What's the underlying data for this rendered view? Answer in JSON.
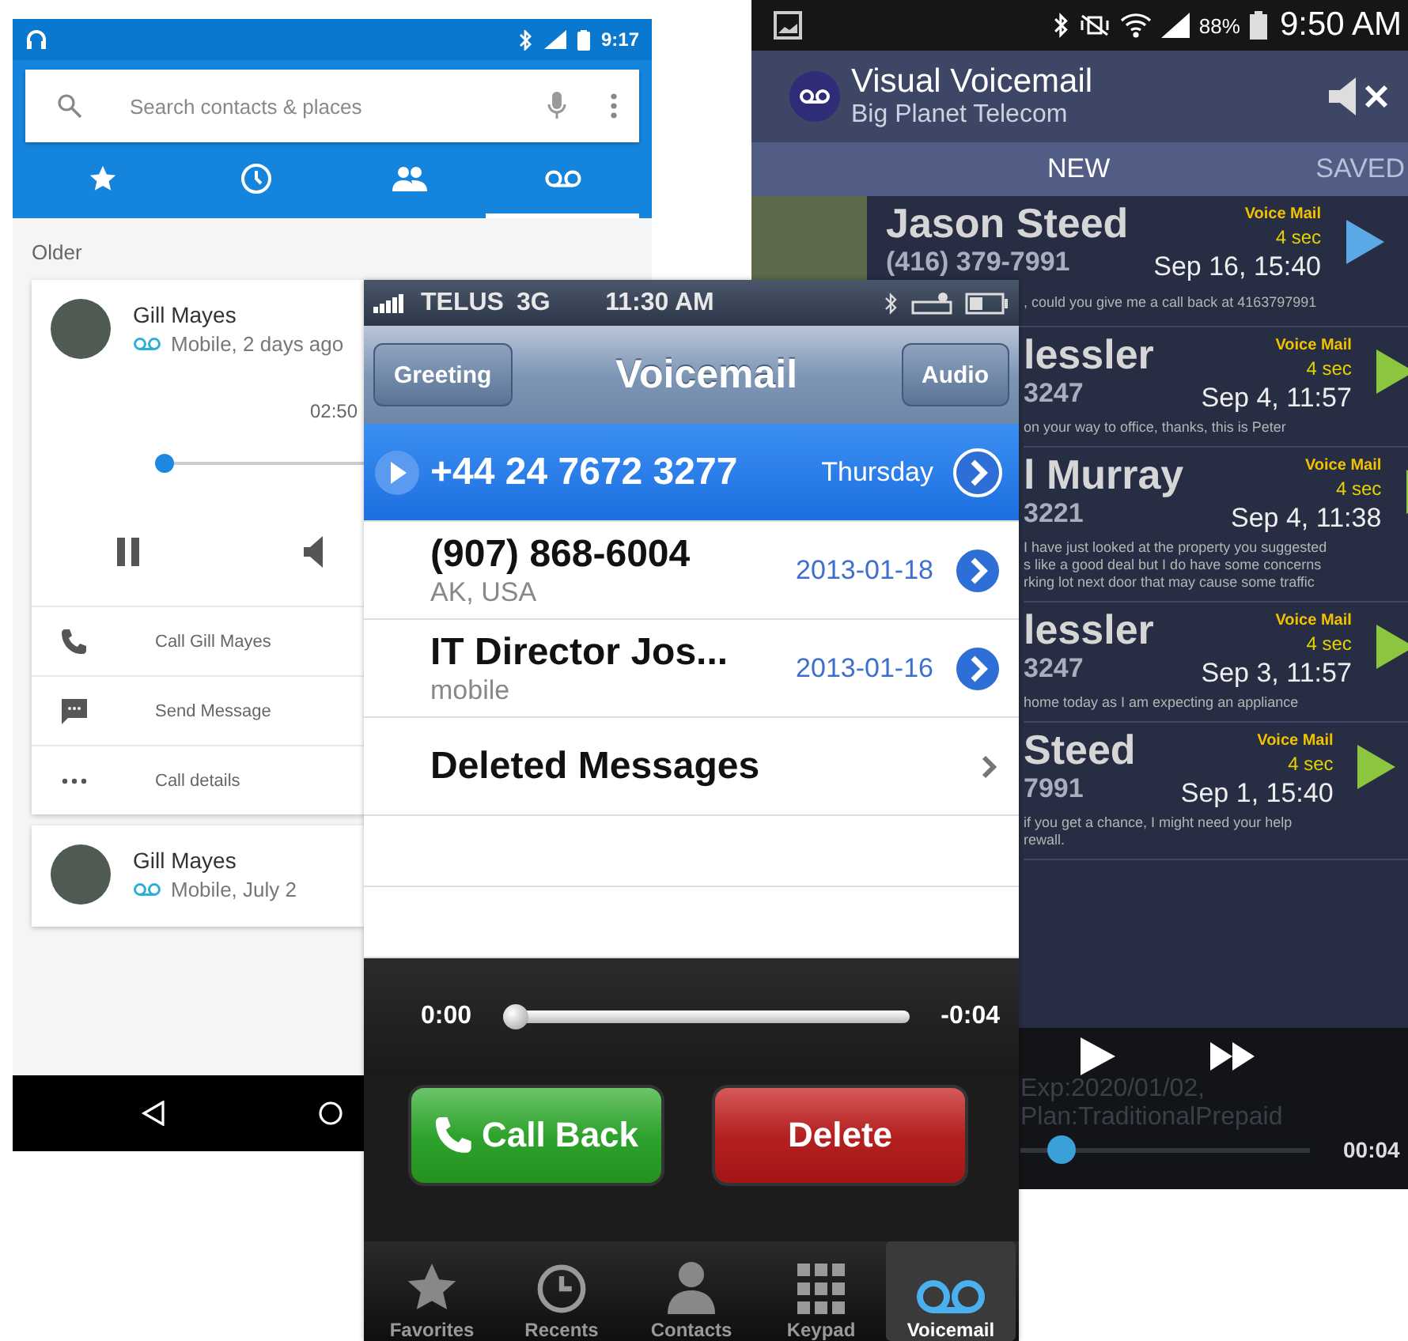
{
  "dialer": {
    "status": {
      "time": "9:17"
    },
    "search": {
      "placeholder": "Search contacts & places"
    },
    "tabs": [
      {
        "kind": "favorites",
        "selected": false
      },
      {
        "kind": "recents",
        "selected": false
      },
      {
        "kind": "contacts",
        "selected": false
      },
      {
        "kind": "voicemail",
        "selected": true
      }
    ],
    "section_header": "Older",
    "voicemails": [
      {
        "name": "Gill Mayes",
        "detail": "Mobile, 2 days ago",
        "expanded": true,
        "duration": "02:50",
        "level": 0.03,
        "actions": [
          {
            "kind": "call",
            "label": "Call Gill Mayes"
          },
          {
            "kind": "message",
            "label": "Send Message"
          },
          {
            "kind": "details",
            "label": "Call details"
          }
        ]
      },
      {
        "name": "Gill Mayes",
        "detail": "Mobile, July 2",
        "expanded": false
      }
    ]
  },
  "visual_voicemail": {
    "status": {
      "battery": "88%",
      "time": "9:50 AM"
    },
    "app": {
      "title": "Visual Voicemail",
      "subtitle": "Big Planet Telecom"
    },
    "tabs": [
      {
        "label": "NEW",
        "selected": true
      },
      {
        "label": "SAVED",
        "selected": false
      }
    ],
    "messages": [
      {
        "photo": true,
        "name": "Jason Steed",
        "number": "(416) 379-7991",
        "type": "Voice Mail",
        "length": "4 sec",
        "date": "Sep 16, 15:40",
        "transcript": [
          ", could you give me a call back at 4163797991"
        ],
        "color": "#5aa9e6"
      },
      {
        "photo": false,
        "name": "lessler",
        "number": "3247",
        "type": "Voice Mail",
        "length": "4 sec",
        "date": "Sep  4, 11:57",
        "transcript": [
          "on your way to office, thanks, this is Peter"
        ],
        "color": "#8cc63f"
      },
      {
        "photo": false,
        "name": "l Murray",
        "number": "3221",
        "type": "Voice Mail",
        "length": "4 sec",
        "date": "Sep  4, 11:38",
        "transcript": [
          "I have just looked at the property you suggested",
          "s like a good deal but I do have some concerns",
          "rking lot next door that may cause some traffic"
        ],
        "color": "#8cc63f"
      },
      {
        "photo": false,
        "name": "lessler",
        "number": "3247",
        "type": "Voice Mail",
        "length": "4 sec",
        "date": "Sep  3, 11:57",
        "transcript": [
          "home today as I am expecting an appliance"
        ],
        "color": "#8cc63f"
      },
      {
        "photo": false,
        "name": "Steed",
        "number": "7991",
        "type": "Voice Mail",
        "length": "4 sec",
        "date": "Sep  1, 15:40",
        "transcript": [
          "if you get a chance, I might need your help",
          "rewall."
        ],
        "color": "#8cc63f"
      }
    ],
    "player": {
      "info": [
        "Exp:2020/01/02,",
        "Plan:TraditionalPrepaid"
      ],
      "level": 0.14,
      "time": "00:04"
    }
  },
  "iphone": {
    "status": {
      "carrier": "TELUS",
      "network": "3G",
      "time": "11:30 AM"
    },
    "nav": {
      "left_button": "Greeting",
      "title": "Voicemail",
      "right_button": "Audio"
    },
    "messages": [
      {
        "caller": "+44 24 7672 3277",
        "date": "Thursday",
        "selected": true
      },
      {
        "caller": "(907) 868-6004",
        "detail": "AK, USA",
        "date": "2013-01-18",
        "selected": false
      },
      {
        "caller": "IT Director Jos...",
        "detail": "mobile",
        "date": "2013-01-16",
        "selected": false
      }
    ],
    "deleted_label": "Deleted Messages",
    "player": {
      "elapsed": "0:00",
      "remaining": "-0:04",
      "level": 0
    },
    "buttons": [
      {
        "kind": "call",
        "label": "Call Back"
      },
      {
        "kind": "delete",
        "label": "Delete"
      }
    ],
    "tabs": [
      {
        "kind": "favorites",
        "label": "Favorites",
        "selected": false
      },
      {
        "kind": "recents",
        "label": "Recents",
        "selected": false
      },
      {
        "kind": "contacts",
        "label": "Contacts",
        "selected": false
      },
      {
        "kind": "keypad",
        "label": "Keypad",
        "selected": false
      },
      {
        "kind": "voicemail",
        "label": "Voicemail",
        "selected": true
      }
    ]
  }
}
